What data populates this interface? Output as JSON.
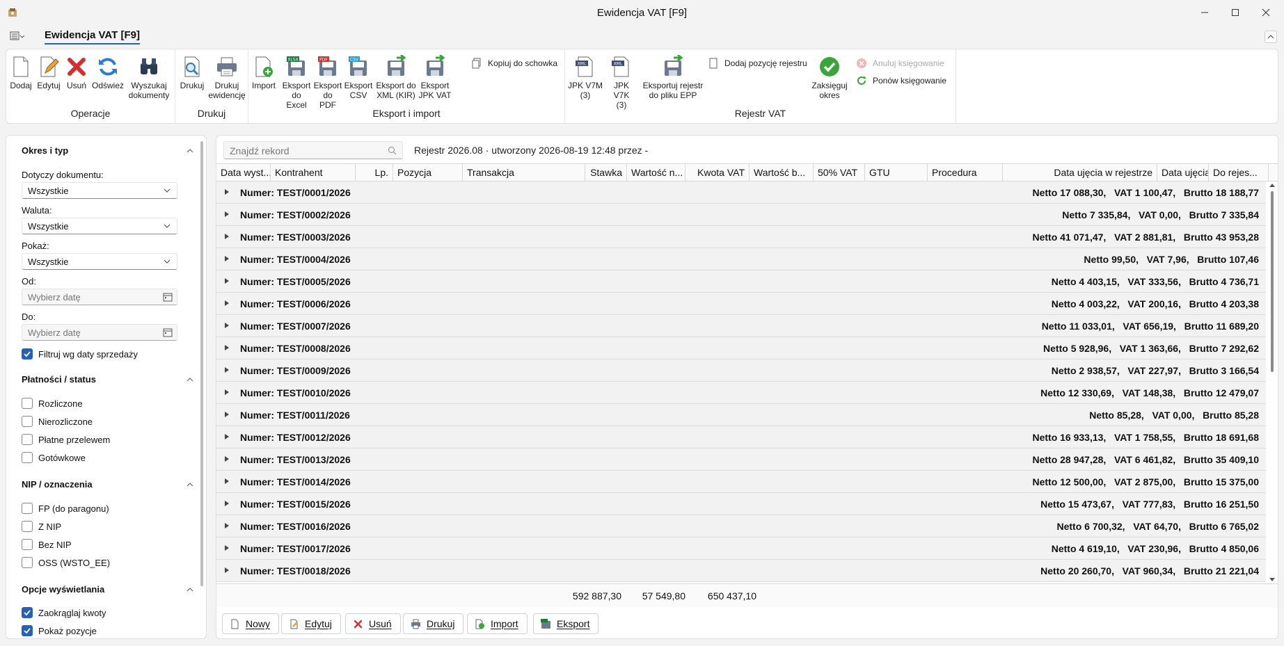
{
  "window": {
    "title": "Ewidencja VAT [F9]"
  },
  "tab": {
    "label": "Ewidencja VAT [F9]"
  },
  "ribbon": {
    "groups": {
      "operacje": "Operacje",
      "drukuj": "Drukuj",
      "eksport": "Eksport i import",
      "rejestr": "Rejestr VAT"
    },
    "dodaj": "Dodaj",
    "edytuj": "Edytuj",
    "usun": "Usuń",
    "odswiez": "Odśwież",
    "wyszukaj_l1": "Wyszukaj",
    "wyszukaj_l2": "dokumenty",
    "drukuj": "Drukuj",
    "drukuj_ew_l1": "Drukuj",
    "drukuj_ew_l2": "ewidencję",
    "import": "Import",
    "excel_l1": "Eksport",
    "excel_l2": "do Excel",
    "pdf_l1": "Eksport",
    "pdf_l2": "do PDF",
    "csv_l1": "Eksport",
    "csv_l2": "CSV",
    "xml_l1": "Eksport do",
    "xml_l2": "XML (KIR)",
    "jpk_l1": "Eksport",
    "jpk_l2": "JPK VAT",
    "kopiuj": "Kopiuj do schowka",
    "v7m_l1": "JPK V7M",
    "v7m_l2": "(3)",
    "v7k_l1": "JPK V7K",
    "v7k_l2": "(3)",
    "epp_l1": "Eksportuj rejestr",
    "epp_l2": "do pliku EPP",
    "dodaj_poz": "Dodaj pozycję rejestru",
    "zaks_l1": "Zaksięguj",
    "zaks_l2": "okres",
    "anuluj": "Anuluj księgowanie",
    "ponow": "Ponów księgowanie"
  },
  "sidebar": {
    "s1": "Okres i typ",
    "dotyczy_label": "Dotyczy dokumentu:",
    "dotyczy_value": "Wszystkie",
    "waluta_label": "Waluta:",
    "waluta_value": "Wszystkie",
    "pokaz_label": "Pokaż:",
    "pokaz_value": "Wszystkie",
    "od_label": "Od:",
    "od_placeholder": "Wybierz datę",
    "do_label": "Do:",
    "do_placeholder": "Wybierz datę",
    "filtruj": "Filtruj wg daty sprzedaży",
    "s2": "Płatności / status",
    "rozliczone": "Rozliczone",
    "nierozliczone": "Nierozliczone",
    "przelew": "Płatne przelewem",
    "gotowkowe": "Gotówkowe",
    "s3": "NIP / oznaczenia",
    "fp": "FP (do paragonu)",
    "znip": "Z NIP",
    "beznip": "Bez NIP",
    "oss": "OSS (WSTO_EE)",
    "s4": "Opcje wyświetlania",
    "zaokraglaj": "Zaokrąglaj kwoty",
    "pokazpoz": "Pokaż pozycje"
  },
  "main": {
    "search_placeholder": "Znajdź rekord",
    "register_info": "Rejestr 2026.08 · utworzony 2026-08-19 12:48 przez -",
    "columns": [
      "Data wyst...",
      "Kontrahent",
      "Lp.",
      "Pozycja",
      "Transakcja",
      "Stawka",
      "Wartość n...",
      "Kwota VAT",
      "Wartość b...",
      "50% VAT",
      "GTU",
      "Procedura",
      "Data ujęcia w rejestrze",
      "Data ujęcia",
      "Do rejes..."
    ],
    "rows": [
      {
        "num": "Numer: TEST/0001/2026",
        "sum": "Netto 17 088,30,   VAT 1 100,47,   Brutto 18 188,77"
      },
      {
        "num": "Numer: TEST/0002/2026",
        "sum": "Netto 7 335,84,   VAT 0,00,   Brutto 7 335,84"
      },
      {
        "num": "Numer: TEST/0003/2026",
        "sum": "Netto 41 071,47,   VAT 2 881,81,   Brutto 43 953,28"
      },
      {
        "num": "Numer: TEST/0004/2026",
        "sum": "Netto 99,50,   VAT 7,96,   Brutto 107,46"
      },
      {
        "num": "Numer: TEST/0005/2026",
        "sum": "Netto 4 403,15,   VAT 333,56,   Brutto 4 736,71"
      },
      {
        "num": "Numer: TEST/0006/2026",
        "sum": "Netto 4 003,22,   VAT 200,16,   Brutto 4 203,38"
      },
      {
        "num": "Numer: TEST/0007/2026",
        "sum": "Netto 11 033,01,   VAT 656,19,   Brutto 11 689,20"
      },
      {
        "num": "Numer: TEST/0008/2026",
        "sum": "Netto 5 928,96,   VAT 1 363,66,   Brutto 7 292,62"
      },
      {
        "num": "Numer: TEST/0009/2026",
        "sum": "Netto 2 938,57,   VAT 227,97,   Brutto 3 166,54"
      },
      {
        "num": "Numer: TEST/0010/2026",
        "sum": "Netto 12 330,69,   VAT 148,38,   Brutto 12 479,07"
      },
      {
        "num": "Numer: TEST/0011/2026",
        "sum": "Netto 85,28,   VAT 0,00,   Brutto 85,28"
      },
      {
        "num": "Numer: TEST/0012/2026",
        "sum": "Netto 16 933,13,   VAT 1 758,55,   Brutto 18 691,68"
      },
      {
        "num": "Numer: TEST/0013/2026",
        "sum": "Netto 28 947,28,   VAT 6 461,82,   Brutto 35 409,10"
      },
      {
        "num": "Numer: TEST/0014/2026",
        "sum": "Netto 12 500,00,   VAT 2 875,00,   Brutto 15 375,00"
      },
      {
        "num": "Numer: TEST/0015/2026",
        "sum": "Netto 15 473,67,   VAT 777,83,   Brutto 16 251,50"
      },
      {
        "num": "Numer: TEST/0016/2026",
        "sum": "Netto 6 700,32,   VAT 64,70,   Brutto 6 765,02"
      },
      {
        "num": "Numer: TEST/0017/2026",
        "sum": "Netto 4 619,10,   VAT 230,96,   Brutto 4 850,06"
      },
      {
        "num": "Numer: TEST/0018/2026",
        "sum": "Netto 20 260,70,   VAT 960,34,   Brutto 21 221,04"
      }
    ],
    "totals": {
      "netto": "592 887,30",
      "vat": "57 549,80",
      "brutto": "650 437,10"
    }
  },
  "bottom": {
    "nowy": "Nowy",
    "edytuj": "Edytuj",
    "usun": "Usuń",
    "drukuj": "Drukuj",
    "import": "Import",
    "eksport": "Eksport"
  },
  "colors": {
    "accent": "#2462b5",
    "delete": "#d32f2f",
    "ok": "#3aa63a"
  }
}
